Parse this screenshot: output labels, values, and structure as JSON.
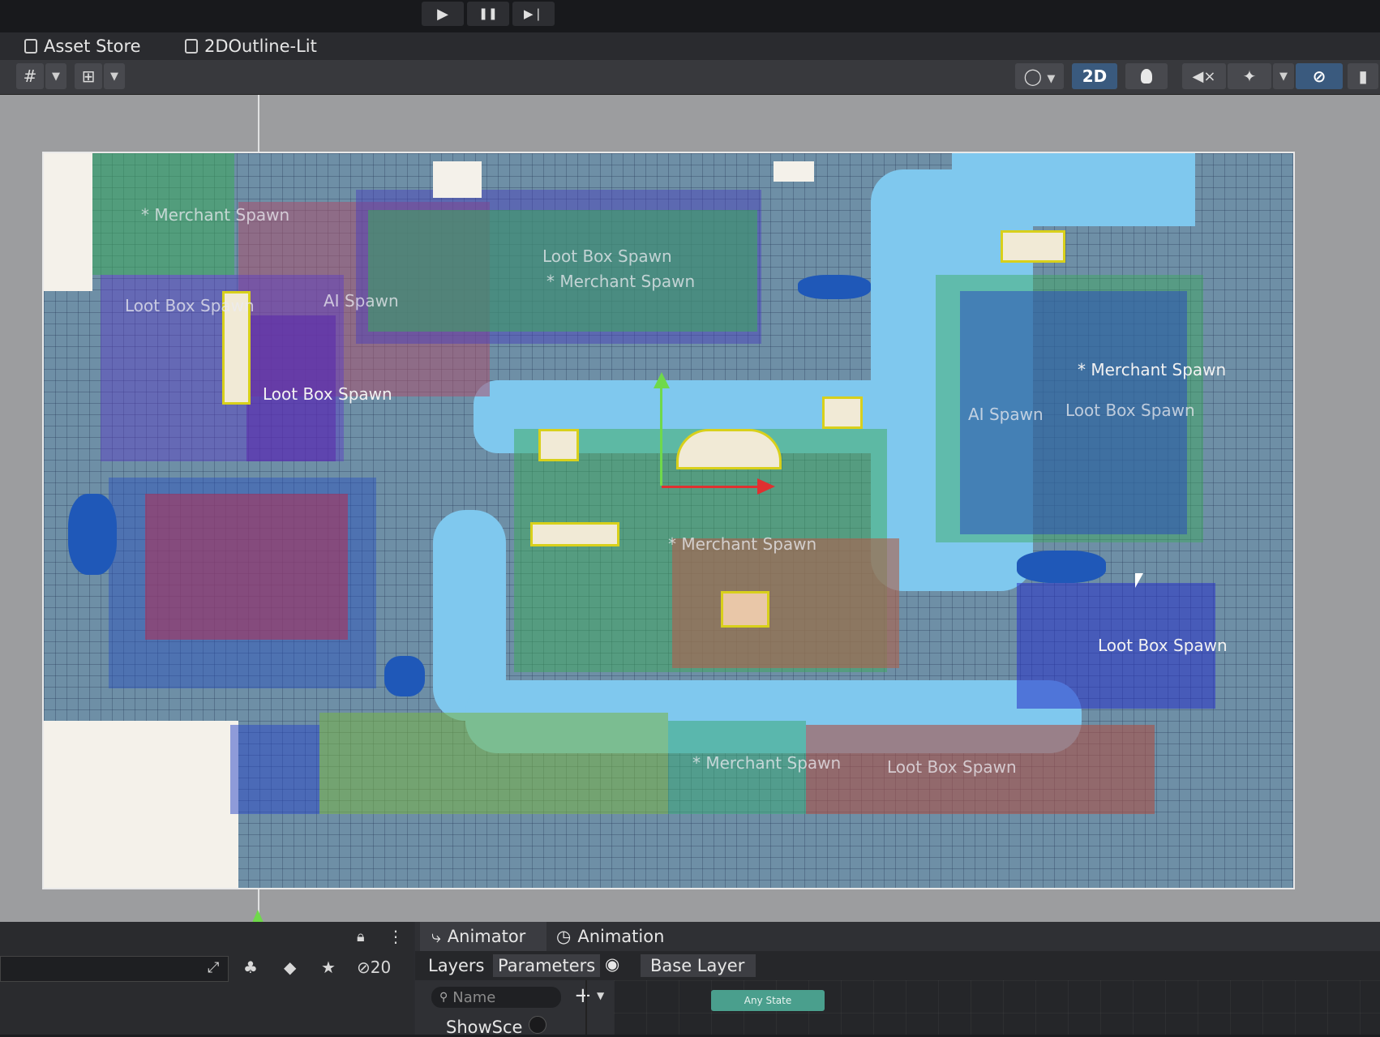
{
  "playbar": {
    "play": "▶",
    "pause": "❚❚",
    "step": "▶❘"
  },
  "tabs": [
    {
      "label": "Asset Store",
      "icon": "bag-icon"
    },
    {
      "label": "2DOutline-Lit",
      "icon": "scene-icon"
    }
  ],
  "toolbar": {
    "mode_2d": "2D",
    "grid_icon": "#",
    "snap_icon": "⊞",
    "light_icon": "💡",
    "audio_icon": "🔇",
    "fx_icon": "✦",
    "vis_icon": "👁",
    "camera_icon": "▮"
  },
  "scene": {
    "labels": [
      "* Merchant Spawn",
      "Loot Box Spawn",
      "* Merchant Spawn",
      "Loot Box Spawn",
      "AI Spawn",
      "Loot Box Spawn",
      "* Merchant Spawn",
      "Loot Box Spawn",
      "AI Spawn",
      "* Merchant Spawn",
      "Loot Box Spawn",
      "* Merchant Spawn",
      "Loot Box Spawn"
    ]
  },
  "bottom": {
    "hierarchy_count": "20",
    "tab_animator": "Animator",
    "tab_animation": "Animation",
    "layers": "Layers",
    "parameters": "Parameters",
    "base_layer": "Base Layer",
    "search_placeholder": "Name",
    "param_row": "ShowSce",
    "any_state": "Any State",
    "add": "+"
  }
}
